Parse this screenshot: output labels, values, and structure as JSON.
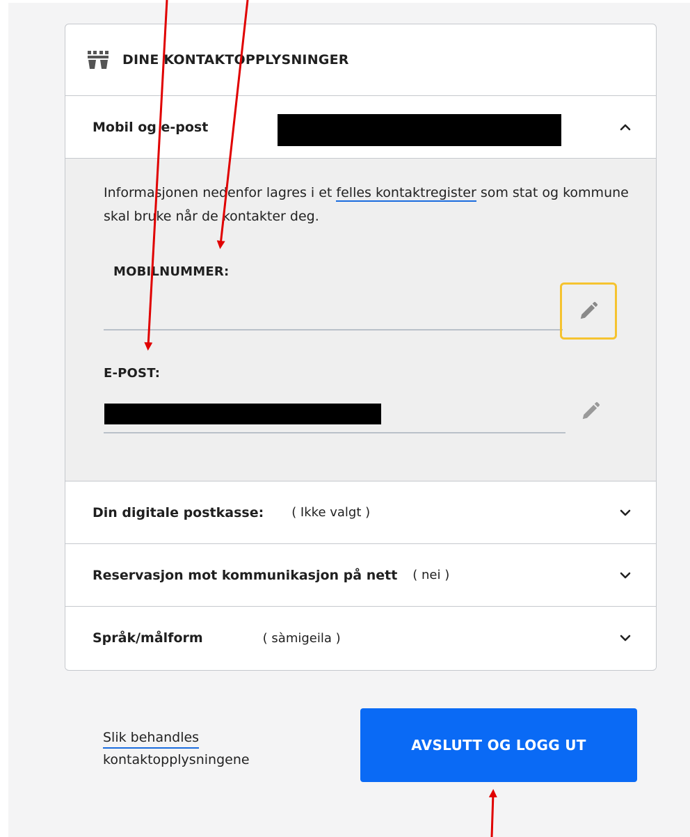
{
  "card": {
    "title": "DINE KONTAKTOPPLYSNINGER"
  },
  "sections": {
    "mobile_email": {
      "label": "Mobil og e-post",
      "info_before": "Informasjonen nedenfor lagres i et ",
      "info_link": "felles kontaktregister",
      "info_after": " som stat og kommune skal bruke når de kontakter deg.",
      "mobile_label": "MOBILNUMMER:",
      "mobile_value": "",
      "email_label": "E-POST:"
    },
    "postbox": {
      "label": "Din digitale postkasse:",
      "value": "( Ikke valgt )"
    },
    "reservation": {
      "label": "Reservasjon mot kommunikasjon på nett",
      "value": "( nei )"
    },
    "language": {
      "label": "Språk/målform",
      "value": "( sàmigeila )"
    }
  },
  "footer": {
    "link_line1": "Slik behandles",
    "link_line2": "kontaktopplysningene",
    "logout_label": "AVSLUTT OG LOGG UT"
  },
  "colors": {
    "primary_button": "#0a6af5",
    "focus_outline": "#f5c330",
    "annotation_arrow": "#e00000"
  },
  "icons": [
    "fortress-icon",
    "chevron-up-icon",
    "chevron-down-icon",
    "pencil-icon"
  ]
}
